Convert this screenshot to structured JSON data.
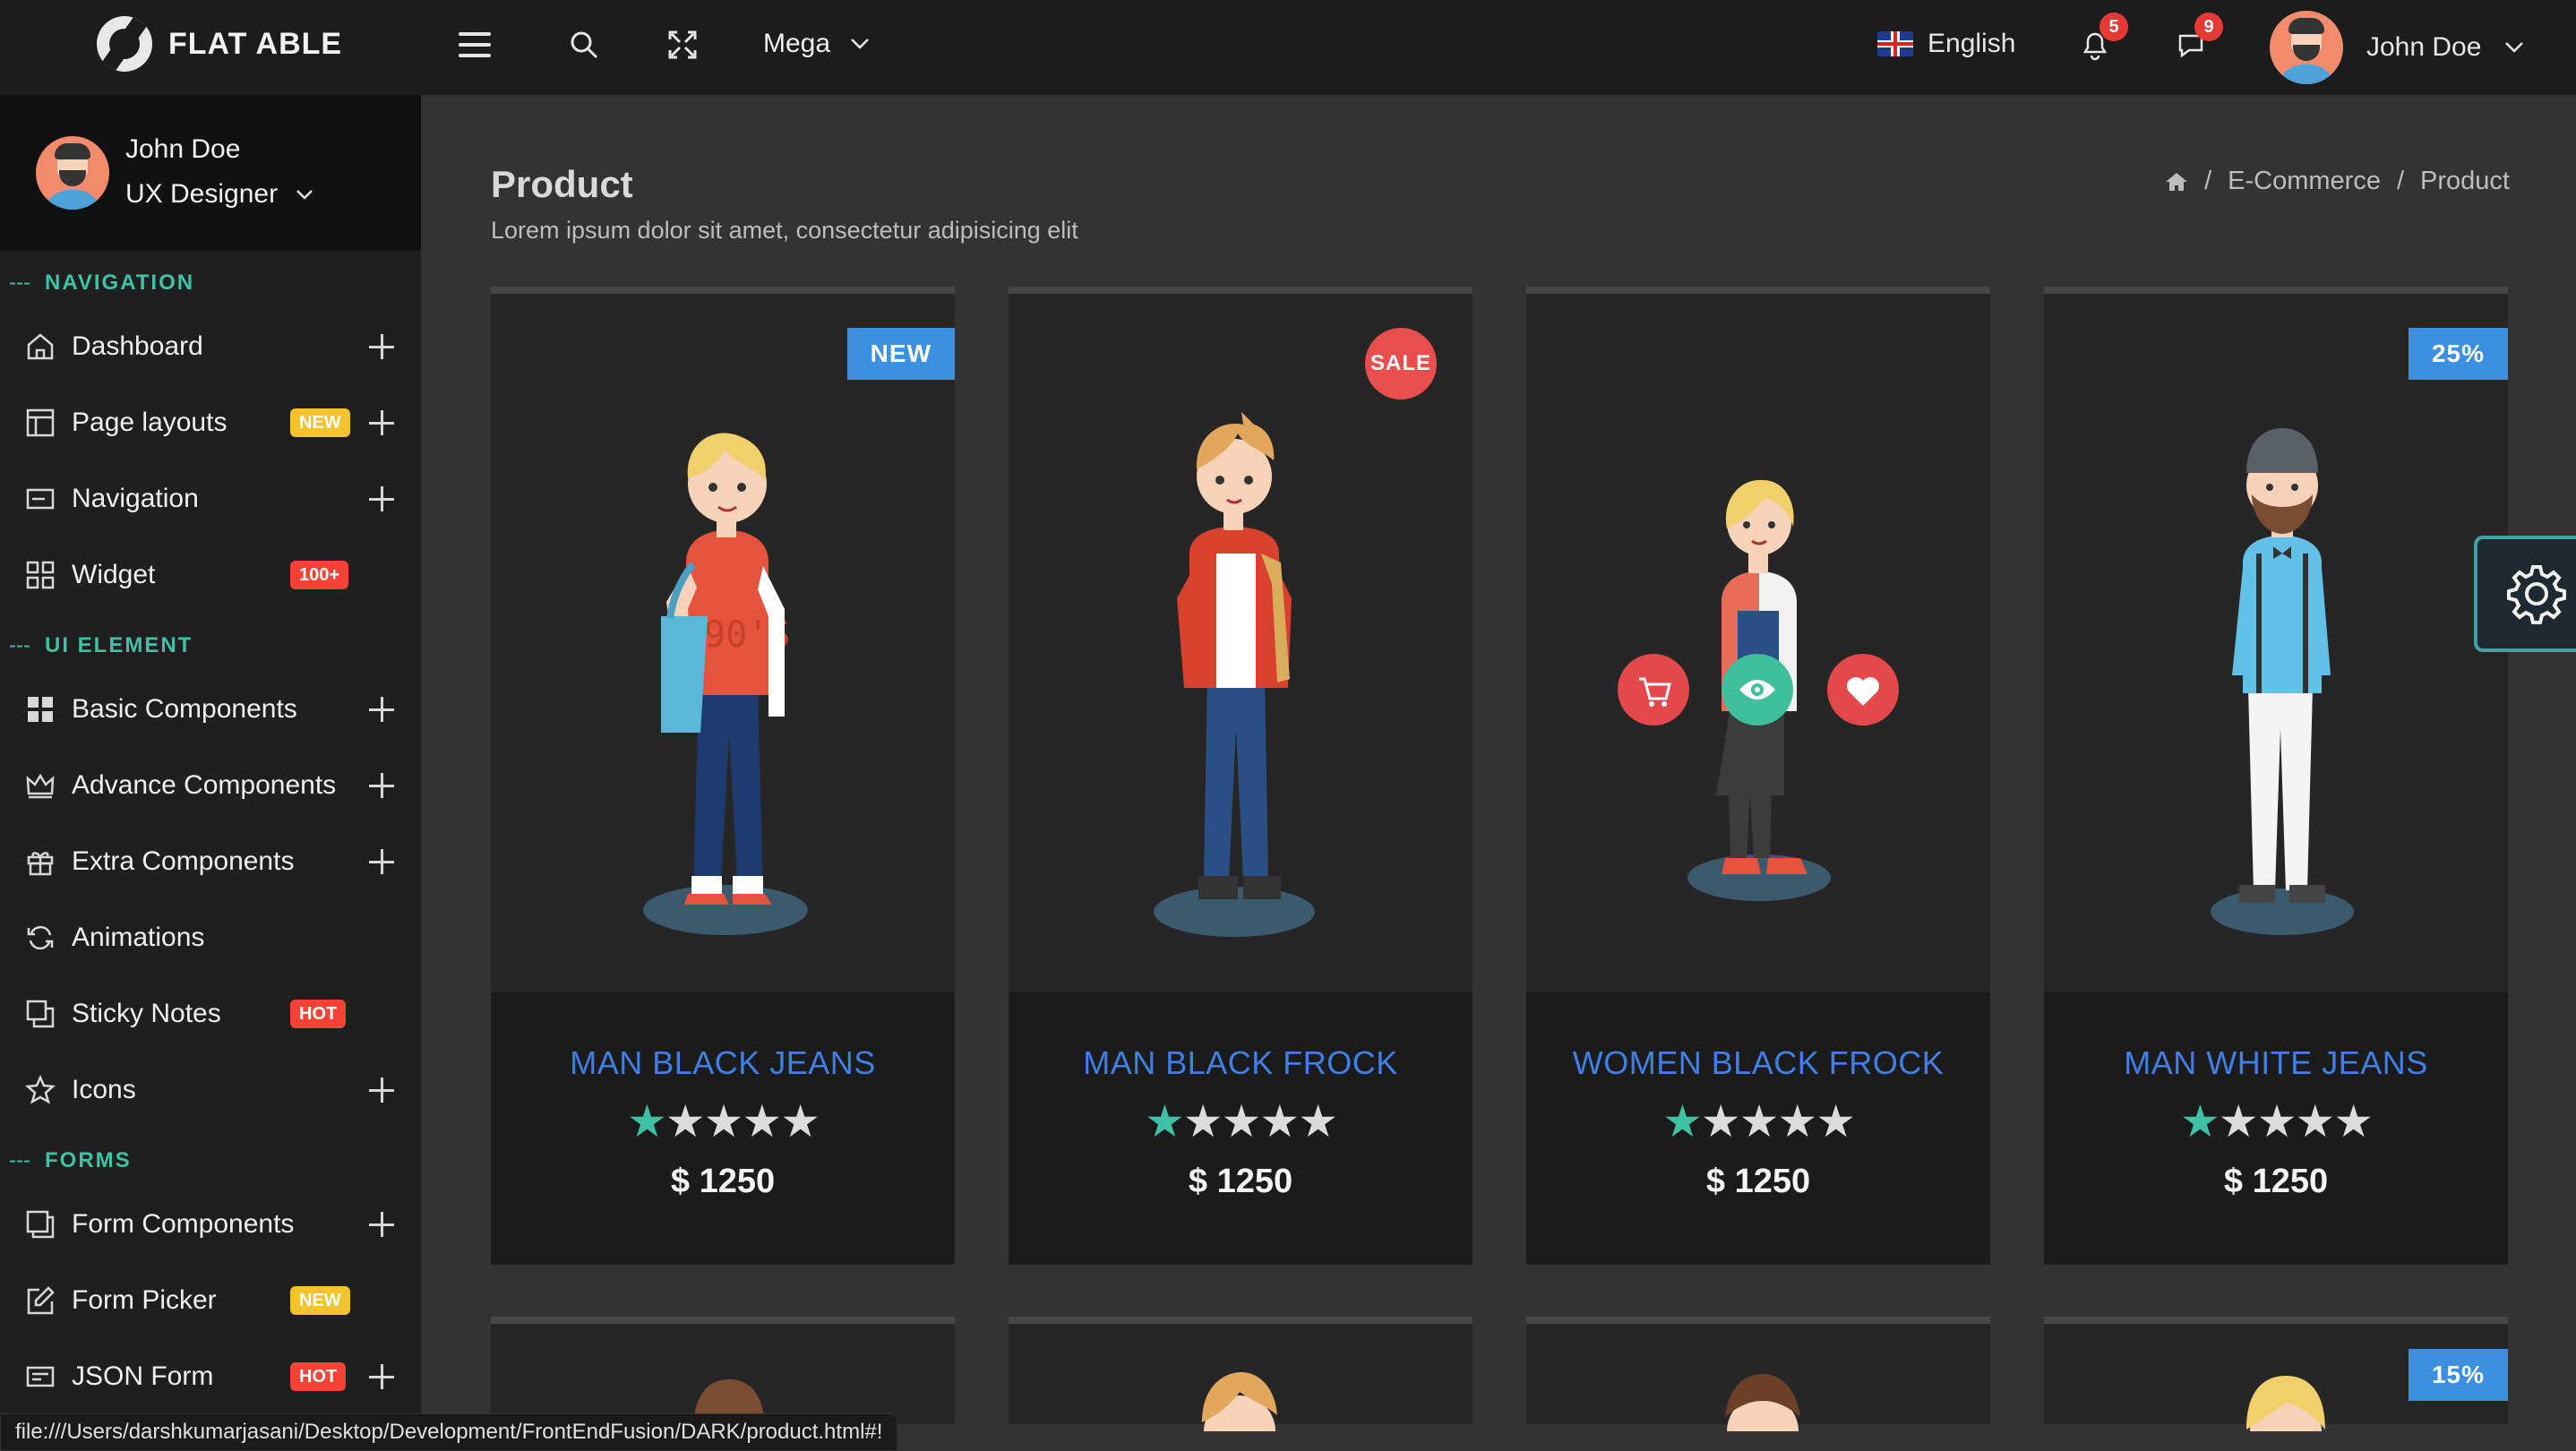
{
  "app": {
    "name": "FLAT ABLE"
  },
  "header": {
    "mega_label": "Mega",
    "language": "English",
    "notifications_count": "5",
    "messages_count": "9",
    "user_name": "John Doe"
  },
  "sidebar": {
    "profile": {
      "name": "John Doe",
      "role": "UX Designer"
    },
    "sections": [
      {
        "title": "NAVIGATION"
      },
      {
        "title": "UI ELEMENT"
      },
      {
        "title": "FORMS"
      }
    ],
    "items": [
      {
        "label": "Dashboard",
        "icon": "home-icon"
      },
      {
        "label": "Page layouts",
        "icon": "layout-icon",
        "tag": "NEW"
      },
      {
        "label": "Navigation",
        "icon": "navigation-icon"
      },
      {
        "label": "Widget",
        "icon": "widget-icon",
        "tag": "100+"
      },
      {
        "label": "Basic Components",
        "icon": "grid-icon"
      },
      {
        "label": "Advance Components",
        "icon": "crown-icon"
      },
      {
        "label": "Extra Components",
        "icon": "gift-icon"
      },
      {
        "label": "Animations",
        "icon": "refresh-icon"
      },
      {
        "label": "Sticky Notes",
        "icon": "notes-icon",
        "tag": "HOT"
      },
      {
        "label": "Icons",
        "icon": "star-icon"
      },
      {
        "label": "Form Components",
        "icon": "form-icon"
      },
      {
        "label": "Form Picker",
        "icon": "edit-icon",
        "tag": "NEW"
      },
      {
        "label": "JSON Form",
        "icon": "json-icon",
        "tag": "HOT"
      }
    ]
  },
  "page": {
    "title": "Product",
    "subtitle": "Lorem ipsum dolor sit amet, consectetur adipisicing elit",
    "breadcrumb": [
      "E-Commerce",
      "Product"
    ]
  },
  "products": [
    {
      "name": "MAN BLACK JEANS",
      "rating": 1,
      "price": "$ 1250",
      "badge": "NEW"
    },
    {
      "name": "MAN BLACK FROCK",
      "rating": 1,
      "price": "$ 1250",
      "badge": "SALE"
    },
    {
      "name": "WOMEN BLACK FROCK",
      "rating": 1,
      "price": "$ 1250",
      "badge": ""
    },
    {
      "name": "MAN WHITE JEANS",
      "rating": 1,
      "price": "$ 1250",
      "badge": "25%"
    }
  ],
  "second_row_badge": "15%",
  "status_bar": "file:///Users/darshkumarjasani/Desktop/Development/FrontEndFusion/DARK/product.html#!",
  "colors": {
    "accent_teal": "#3fc1a5",
    "product_link": "#3f7fe6",
    "badge_blue": "#3d8fe0",
    "badge_red": "#e84e4e",
    "tag_yellow": "#f4c22b"
  }
}
